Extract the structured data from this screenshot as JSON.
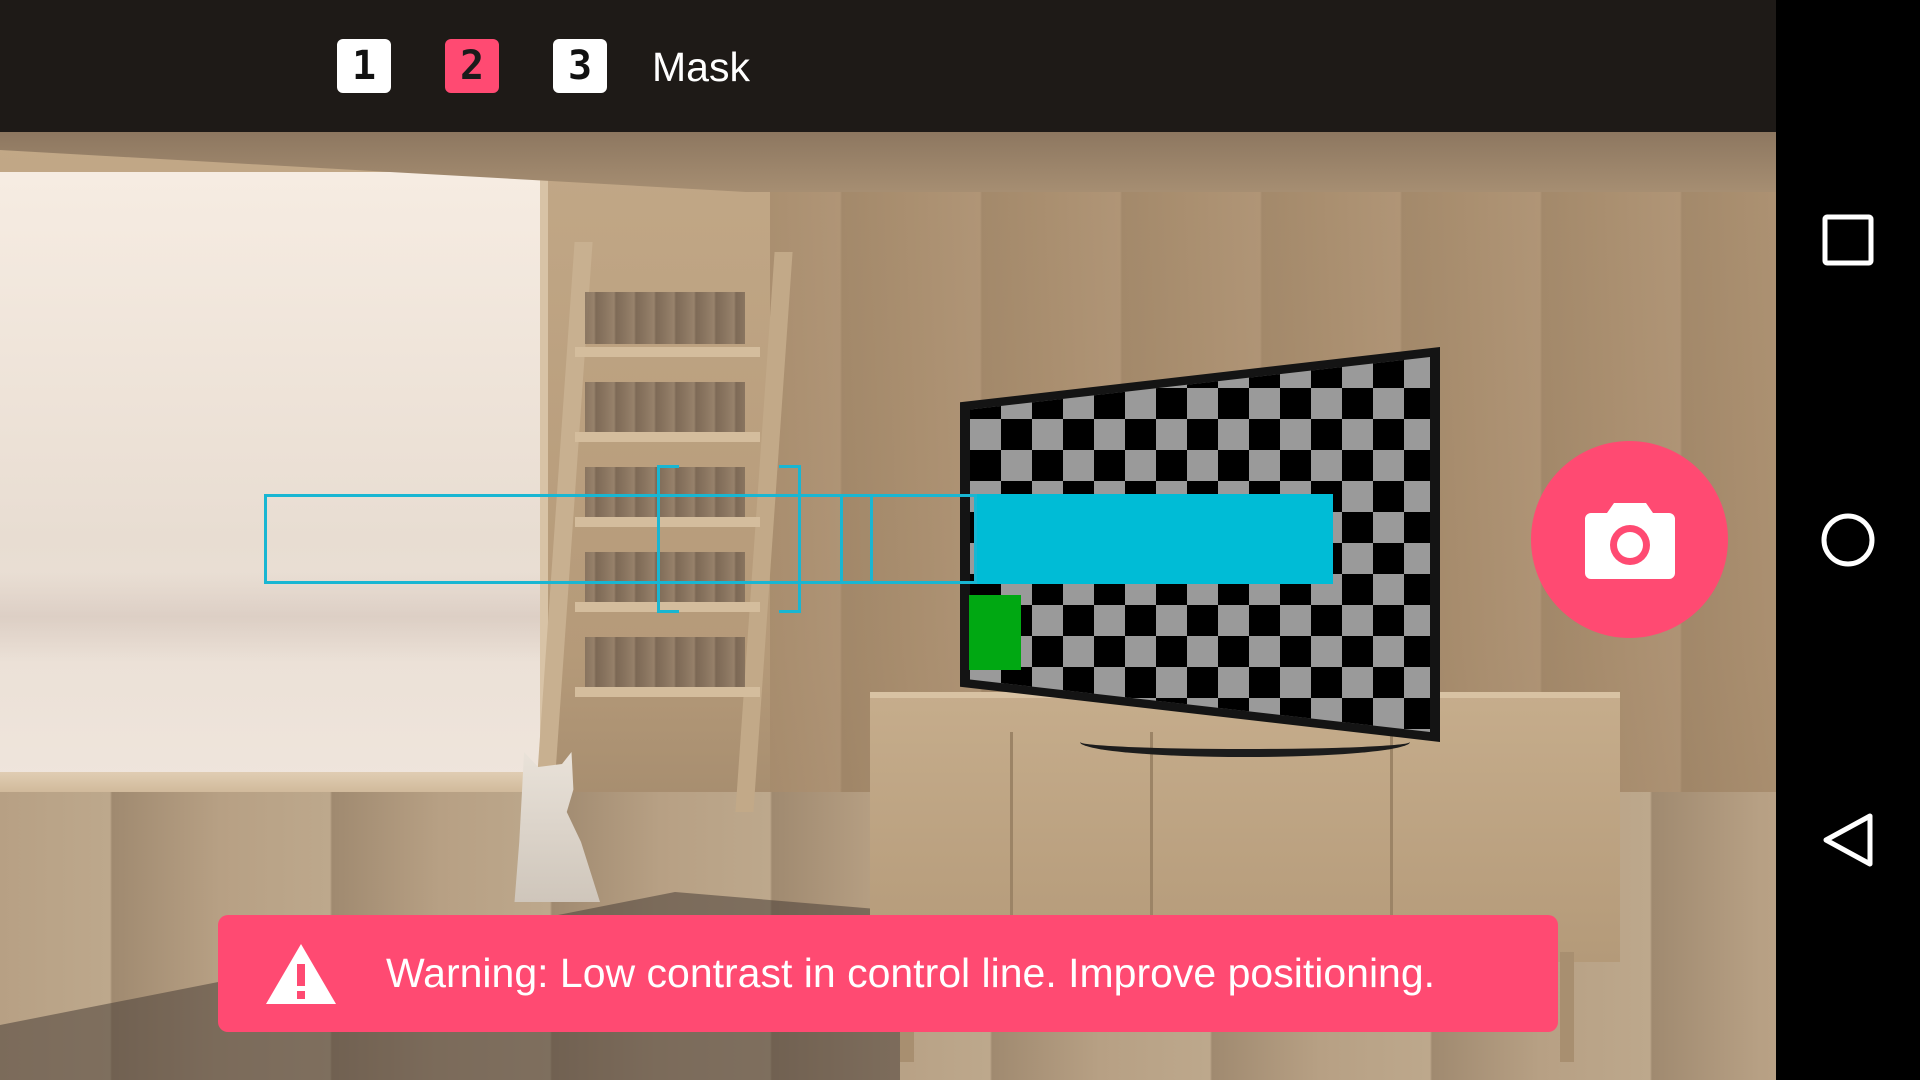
{
  "topbar": {
    "steps": [
      {
        "label": "1",
        "active": false
      },
      {
        "label": "2",
        "active": true
      },
      {
        "label": "3",
        "active": false
      }
    ],
    "mode_label": "Mask"
  },
  "capture": {
    "icon": "camera-icon"
  },
  "warning": {
    "icon": "warning-triangle-icon",
    "text": "Warning: Low contrast in control line. Improve positioning."
  },
  "navbar": {
    "icons": [
      "recent-apps-icon",
      "home-icon",
      "back-icon"
    ]
  },
  "colors": {
    "accent": "#ff4a72",
    "guide": "#19b6d2",
    "strip_fill": "#00bcd6",
    "control_marker": "#00a812",
    "topbar_bg": "#1e1a17"
  }
}
